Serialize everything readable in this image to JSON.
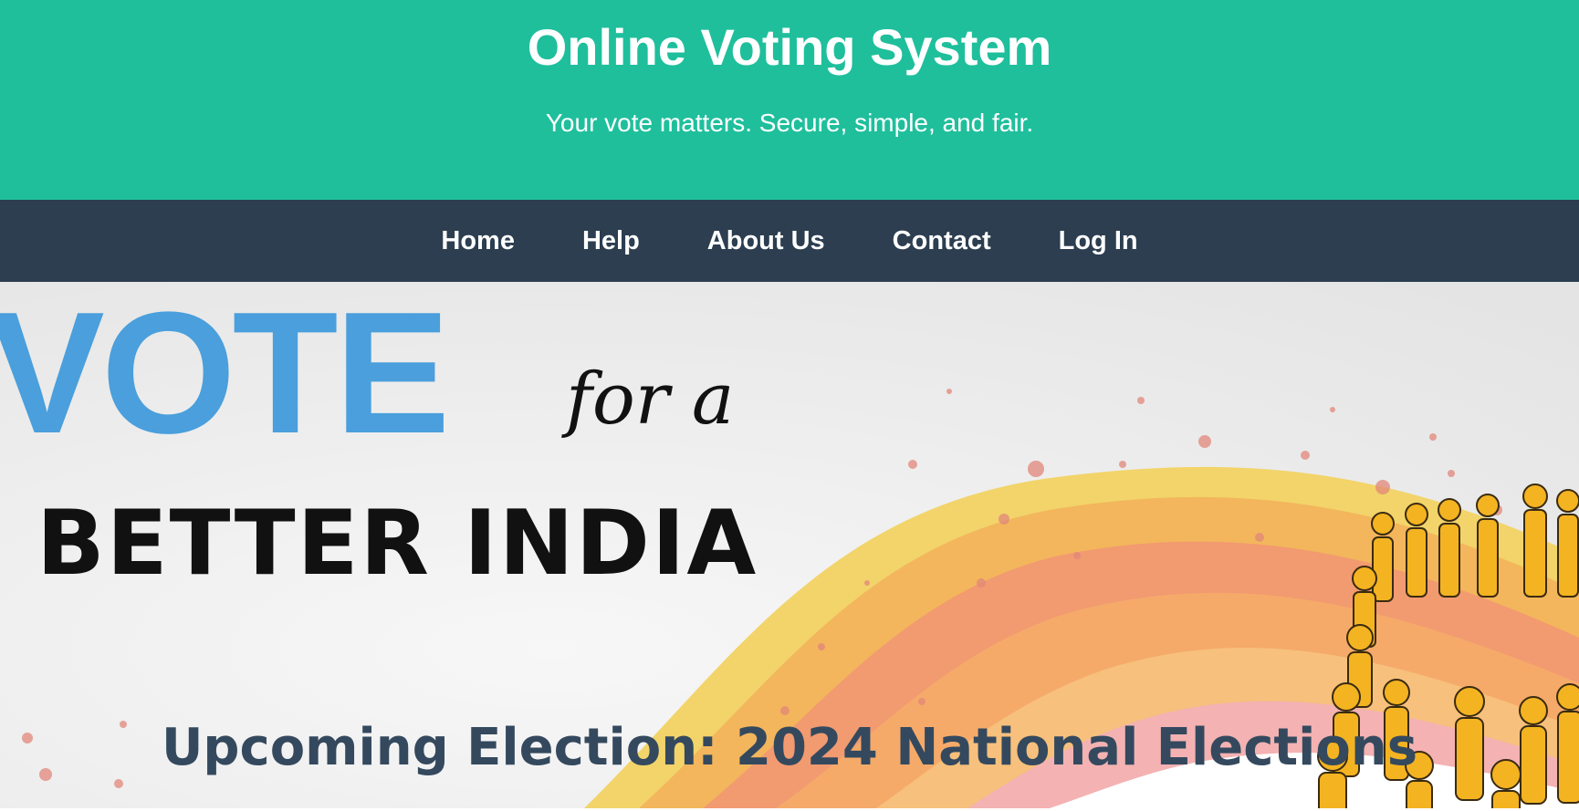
{
  "header": {
    "title": "Online Voting System",
    "tagline": "Your vote matters. Secure, simple, and fair."
  },
  "nav": {
    "items": [
      {
        "label": "Home"
      },
      {
        "label": "Help"
      },
      {
        "label": "About Us"
      },
      {
        "label": "Contact"
      },
      {
        "label": "Log In"
      }
    ]
  },
  "banner": {
    "word_vote": "VOTE",
    "word_for_a": "for a",
    "word_better_india": "BETTER INDIA"
  },
  "hero": {
    "heading": "Upcoming Election: 2024 National Elections"
  },
  "colors": {
    "header_bg": "#1fbf9c",
    "nav_bg": "#2c3e50",
    "heading_color": "#34495e",
    "vote_blue": "#4a9fdc"
  }
}
